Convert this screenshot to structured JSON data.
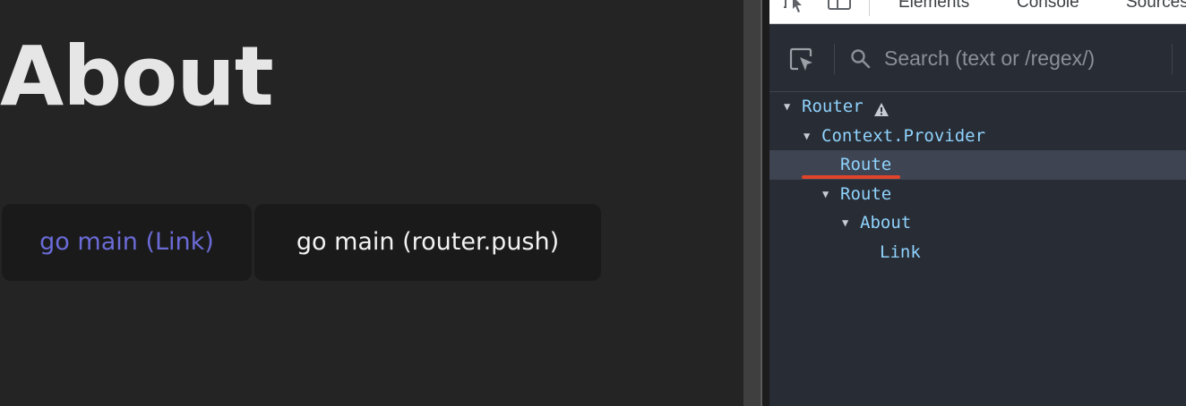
{
  "page": {
    "title": "About",
    "buttons": {
      "link_label": "go main (Link)",
      "push_label": "go main (router.push)"
    }
  },
  "devtools": {
    "tabs": [
      "Elements",
      "Console",
      "Sources"
    ],
    "search": {
      "placeholder": "Search (text or /regex/)"
    },
    "tree": [
      {
        "label": "Router",
        "expanded": true,
        "warning": true
      },
      {
        "label": "Context.Provider",
        "expanded": true
      },
      {
        "label": "Route",
        "selected": true
      },
      {
        "label": "Route",
        "expanded": true
      },
      {
        "label": "About",
        "expanded": true
      },
      {
        "label": "Link"
      }
    ]
  },
  "colors": {
    "page_background": "#242424",
    "link_text": "#6b6bd8",
    "component_name": "#8fd3fe",
    "selected_row": "#3e4451",
    "annotation_underline": "#e0442b",
    "warning_icon": "#c7ccd4"
  },
  "icons": [
    "element-picker-icon",
    "device-toolbar-icon",
    "select-component-icon",
    "search-icon",
    "warning-icon",
    "expand-arrow-icon"
  ]
}
